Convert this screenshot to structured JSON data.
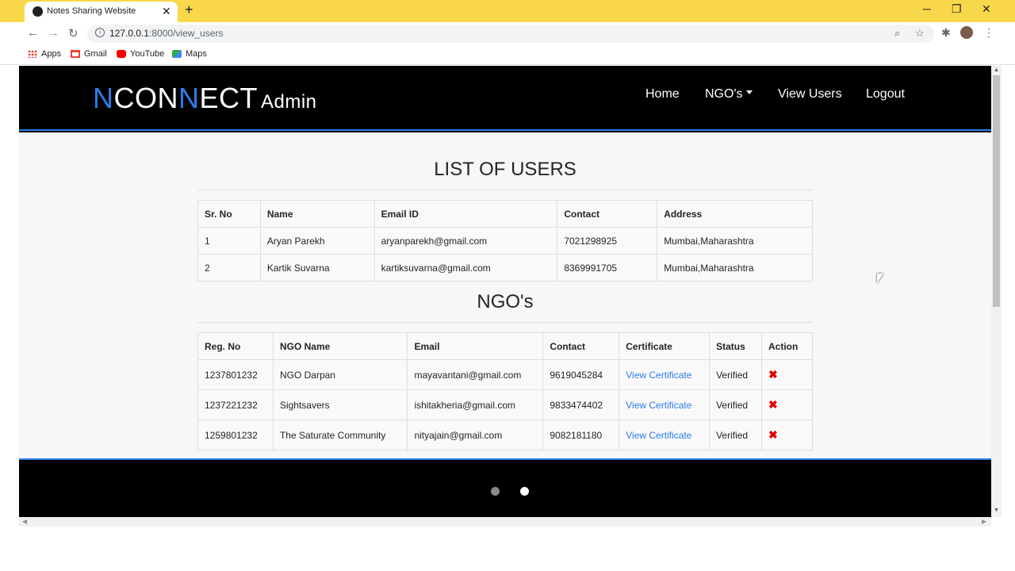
{
  "browser": {
    "tab_title": "Notes Sharing Website",
    "tab_close": "✕",
    "new_tab": "+",
    "url_host": "127.0.0.1",
    "url_rest": ":8000/view_users",
    "bookmarks": [
      "Apps",
      "Gmail",
      "YouTube",
      "Maps"
    ],
    "icons": {
      "back": "←",
      "forward": "→",
      "reload": "↻",
      "zoom": "⌕",
      "star": "☆",
      "extensions": "✱",
      "menu": "⋮",
      "minimize": "─",
      "restore": "❐",
      "close": "✕"
    }
  },
  "site": {
    "logo_n1": "N",
    "logo_con": "CON",
    "logo_n2": "N",
    "logo_ect": "ECT",
    "logo_admin": "Admin",
    "nav": {
      "home": "Home",
      "ngos": "NGO's",
      "view_users": "View Users",
      "logout": "Logout"
    }
  },
  "users": {
    "title": "LIST OF USERS",
    "columns": [
      "Sr. No",
      "Name",
      "Email ID",
      "Contact",
      "Address"
    ],
    "rows": [
      [
        "1",
        "Aryan Parekh",
        "aryanparekh@gmail.com",
        "7021298925",
        "Mumbai,Maharashtra"
      ],
      [
        "2",
        "Kartik Suvarna",
        "kartiksuvarna@gmail.com",
        "8369991705",
        "Mumbai,Maharashtra"
      ]
    ]
  },
  "ngos": {
    "title": "NGO's",
    "columns": [
      "Reg. No",
      "NGO Name",
      "Email",
      "Contact",
      "Certificate",
      "Status",
      "Action"
    ],
    "rows": [
      [
        "1237801232",
        "NGO Darpan",
        "mayavantani@gmail.com",
        "9619045284",
        "View Certificate",
        "Verified",
        "✖"
      ],
      [
        "1237221232",
        "Sightsavers",
        "ishitakheria@gmail.com",
        "9833474402",
        "View Certificate",
        "Verified",
        "✖"
      ],
      [
        "1259801232",
        "The Saturate Community",
        "nityajain@gmail.com",
        "9082181180",
        "View Certificate",
        "Verified",
        "✖"
      ]
    ]
  },
  "colors": {
    "accent": "#2b7de9",
    "chrome_tabstrip": "#f8d84a",
    "delete": "#e00000"
  }
}
